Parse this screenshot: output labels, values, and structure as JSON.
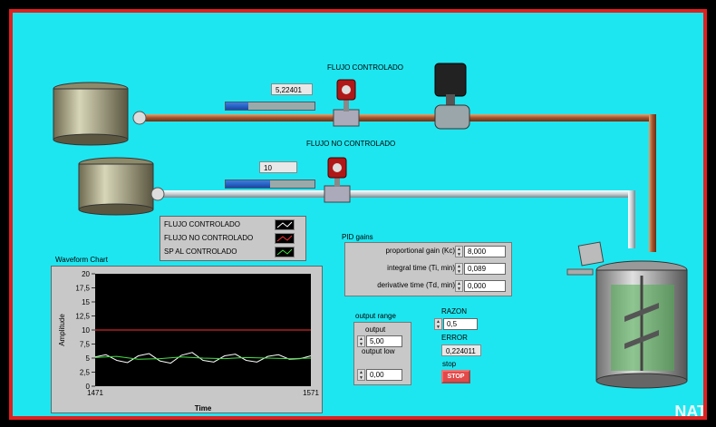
{
  "tanks": {
    "flujo_controlado": {
      "title": "FLUJO CONTROLADO",
      "value": "5,22401",
      "level": 0.25
    },
    "flujo_no_controlado": {
      "title": "FLUJO NO CONTROLADO",
      "value": "10",
      "level": 0.5
    }
  },
  "legend": {
    "items": [
      {
        "label": "FLUJO CONTROLADO",
        "color": "#ffffff"
      },
      {
        "label": "FLUJO NO CONTROLADO",
        "color": "#ff3030"
      },
      {
        "label": "SP AL CONTROLADO",
        "color": "#40e040"
      }
    ]
  },
  "pid": {
    "title": "PID gains",
    "kc_label": "proportional gain (Kc)",
    "kc_value": "8,000",
    "ti_label": "integral time (Ti, min)",
    "ti_value": "0,089",
    "td_label": "derivative time (Td, min)",
    "td_value": "0,000"
  },
  "output_range": {
    "title": "output range",
    "high_label": "output",
    "high_value": "5,00",
    "low_label": "output low",
    "low_value": "0,00"
  },
  "razon": {
    "label": "RAZON",
    "value": "0,5"
  },
  "error": {
    "label": "ERROR",
    "value": "0,224011"
  },
  "stop": {
    "label": "stop",
    "button": "STOP"
  },
  "watermark": "NATIONAL INSTRUMENTS",
  "chart_data": {
    "type": "line",
    "title": "Waveform Chart",
    "xlabel": "Time",
    "ylabel": "Amplitude",
    "xlim": [
      1471,
      1571
    ],
    "ylim": [
      0,
      20
    ],
    "yticks": [
      "20",
      "17,5",
      "15",
      "12,5",
      "10",
      "7,5",
      "5",
      "2,5",
      "0"
    ],
    "xticks": [
      "1471",
      "1571"
    ],
    "background": "#000000",
    "series": [
      {
        "name": "FLUJO CONTROLADO",
        "color": "#ffffff",
        "x": [
          1471,
          1476,
          1481,
          1486,
          1491,
          1496,
          1501,
          1506,
          1511,
          1516,
          1521,
          1526,
          1531,
          1536,
          1541,
          1546,
          1551,
          1556,
          1561,
          1566,
          1571
        ],
        "y": [
          5.2,
          5.6,
          4.6,
          4.2,
          5.4,
          5.8,
          4.5,
          4.1,
          5.5,
          6.0,
          4.6,
          4.3,
          5.4,
          5.7,
          4.6,
          4.3,
          5.3,
          5.6,
          4.8,
          4.9,
          5.4
        ]
      },
      {
        "name": "FLUJO NO CONTROLADO",
        "color": "#ff3030",
        "x": [
          1471,
          1571
        ],
        "y": [
          10,
          10
        ]
      },
      {
        "name": "SP AL CONTROLADO",
        "color": "#40e040",
        "x": [
          1471,
          1481,
          1491,
          1501,
          1511,
          1521,
          1531,
          1541,
          1551,
          1561,
          1571
        ],
        "y": [
          5.1,
          5.3,
          4.8,
          4.9,
          5.2,
          5.0,
          4.9,
          5.1,
          5.0,
          4.9,
          5.0
        ]
      }
    ]
  }
}
